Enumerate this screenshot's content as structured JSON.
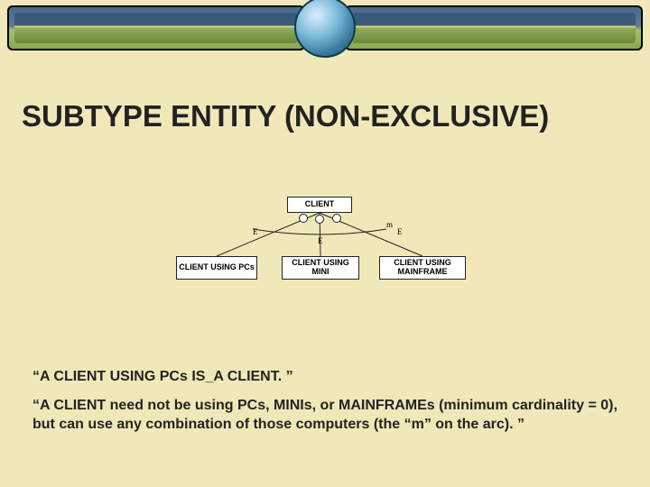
{
  "title": "SUBTYPE ENTITY (NON-EXCLUSIVE)",
  "diagram": {
    "supertype": "CLIENT",
    "subtypes": [
      "CLIENT USING PCs",
      "CLIENT USING MINI",
      "CLIENT USING MAINFRAME"
    ],
    "arc_label": "m",
    "rel_symbol": "E"
  },
  "notes": {
    "n1": "“A CLIENT USING PCs IS_A CLIENT. ”",
    "n2": "“A CLIENT need not be using PCs, MINIs, or MAINFRAMEs (minimum cardinality = 0), but can use any combination of those computers (the “m” on the arc). ”"
  }
}
